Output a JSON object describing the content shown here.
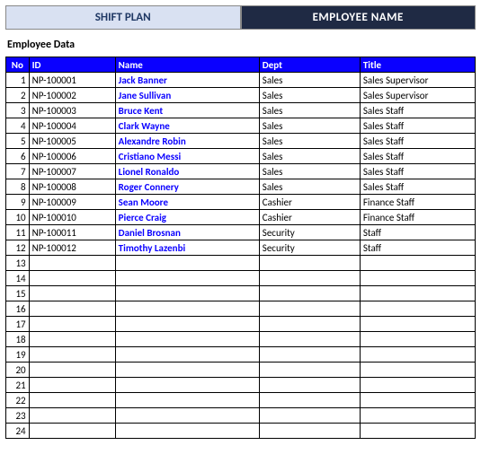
{
  "header": {
    "tab_shift": "SHIFT PLAN",
    "tab_employee": "EMPLOYEE NAME"
  },
  "section_title": "Employee Data",
  "table": {
    "columns": {
      "no": "No",
      "id": "ID",
      "name": "Name",
      "dept": "Dept",
      "title": "Title"
    },
    "rows": [
      {
        "no": "1",
        "id": "NP-100001",
        "name": "Jack Banner",
        "dept": "Sales",
        "title": "Sales Supervisor"
      },
      {
        "no": "2",
        "id": "NP-100002",
        "name": "Jane Sullivan",
        "dept": "Sales",
        "title": "Sales Supervisor"
      },
      {
        "no": "3",
        "id": "NP-100003",
        "name": "Bruce Kent",
        "dept": "Sales",
        "title": "Sales Staff"
      },
      {
        "no": "4",
        "id": "NP-100004",
        "name": "Clark Wayne",
        "dept": "Sales",
        "title": "Sales Staff"
      },
      {
        "no": "5",
        "id": "NP-100005",
        "name": "Alexandre Robin",
        "dept": "Sales",
        "title": "Sales Staff"
      },
      {
        "no": "6",
        "id": "NP-100006",
        "name": "Cristiano Messi",
        "dept": "Sales",
        "title": "Sales Staff"
      },
      {
        "no": "7",
        "id": "NP-100007",
        "name": "Lionel Ronaldo",
        "dept": "Sales",
        "title": "Sales Staff"
      },
      {
        "no": "8",
        "id": "NP-100008",
        "name": "Roger Connery",
        "dept": "Sales",
        "title": "Sales Staff"
      },
      {
        "no": "9",
        "id": "NP-100009",
        "name": "Sean Moore",
        "dept": "Cashier",
        "title": "Finance Staff"
      },
      {
        "no": "10",
        "id": "NP-100010",
        "name": "Pierce Craig",
        "dept": "Cashier",
        "title": "Finance Staff"
      },
      {
        "no": "11",
        "id": "NP-100011",
        "name": "Daniel Brosnan",
        "dept": "Security",
        "title": "Staff"
      },
      {
        "no": "12",
        "id": "NP-100012",
        "name": "Timothy Lazenbi",
        "dept": "Security",
        "title": "Staff"
      },
      {
        "no": "13",
        "id": "",
        "name": "",
        "dept": "",
        "title": ""
      },
      {
        "no": "14",
        "id": "",
        "name": "",
        "dept": "",
        "title": ""
      },
      {
        "no": "15",
        "id": "",
        "name": "",
        "dept": "",
        "title": ""
      },
      {
        "no": "16",
        "id": "",
        "name": "",
        "dept": "",
        "title": ""
      },
      {
        "no": "17",
        "id": "",
        "name": "",
        "dept": "",
        "title": ""
      },
      {
        "no": "18",
        "id": "",
        "name": "",
        "dept": "",
        "title": ""
      },
      {
        "no": "19",
        "id": "",
        "name": "",
        "dept": "",
        "title": ""
      },
      {
        "no": "20",
        "id": "",
        "name": "",
        "dept": "",
        "title": ""
      },
      {
        "no": "21",
        "id": "",
        "name": "",
        "dept": "",
        "title": ""
      },
      {
        "no": "22",
        "id": "",
        "name": "",
        "dept": "",
        "title": ""
      },
      {
        "no": "23",
        "id": "",
        "name": "",
        "dept": "",
        "title": ""
      },
      {
        "no": "24",
        "id": "",
        "name": "",
        "dept": "",
        "title": ""
      }
    ]
  }
}
